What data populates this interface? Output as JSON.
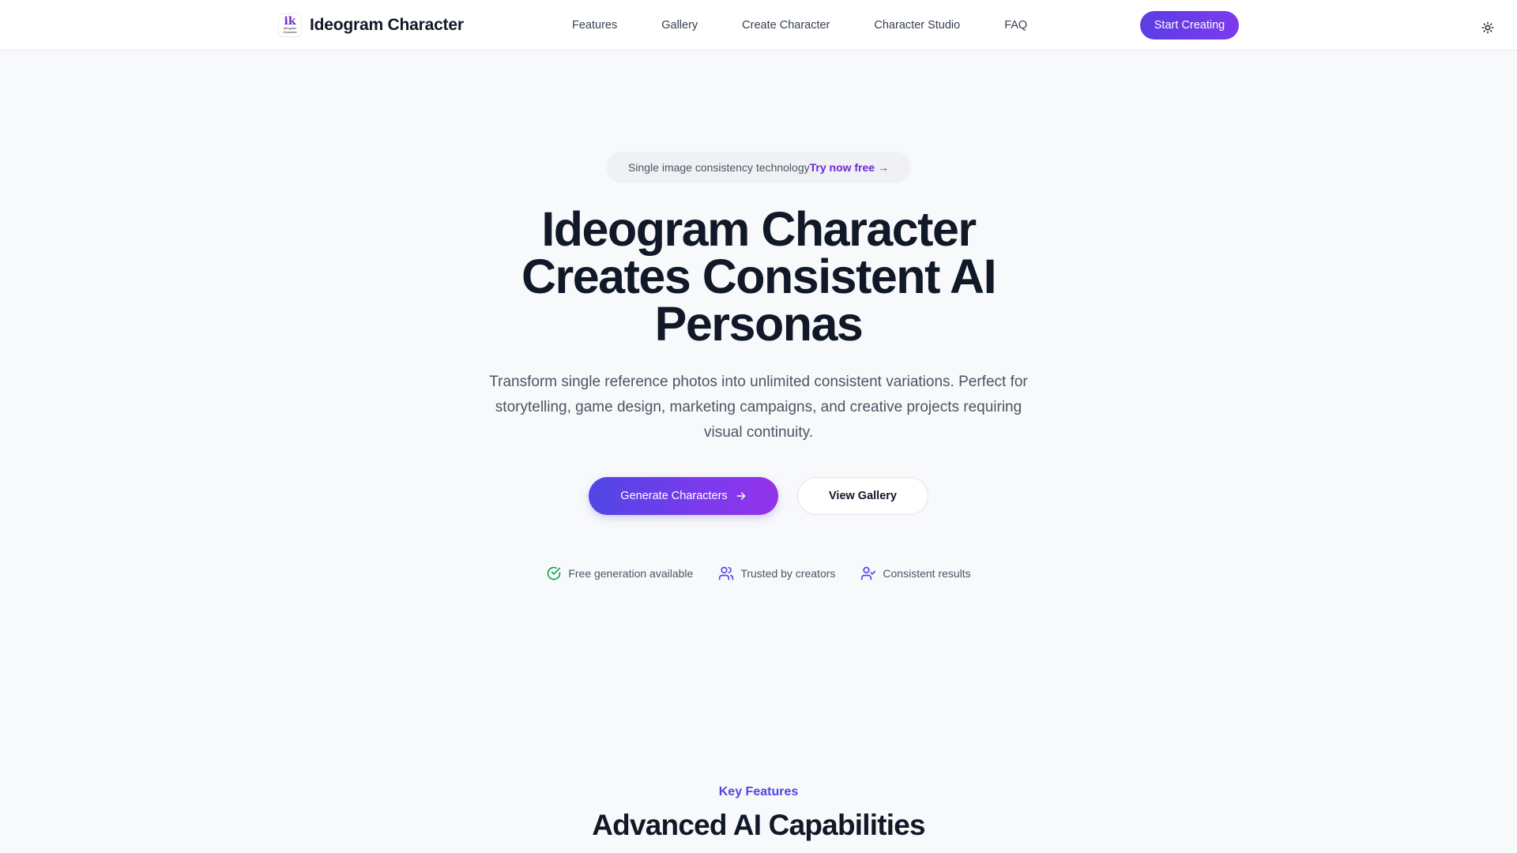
{
  "header": {
    "brand_name": "Ideogram Character",
    "logo_mark": "ik",
    "logo_text": "Ideogram Character",
    "nav": [
      {
        "label": "Features"
      },
      {
        "label": "Gallery"
      },
      {
        "label": "Create Character"
      },
      {
        "label": "Character Studio"
      },
      {
        "label": "FAQ"
      }
    ],
    "cta_label": "Start Creating",
    "theme_icon": "sun-icon"
  },
  "hero": {
    "pill_text": "Single image consistency technology",
    "pill_link": "Try now free →",
    "title_lines": [
      "Ideogram Character",
      "Creates Consistent AI",
      "Personas"
    ],
    "subtitle": "Transform single reference photos into unlimited consistent variations. Perfect for storytelling, game design, marketing campaigns, and creative projects requiring visual continuity.",
    "primary_button": "Generate Characters",
    "secondary_button": "View Gallery",
    "badges": [
      {
        "label": "Free generation available",
        "icon": "check-circle-icon",
        "color": "#16a34a"
      },
      {
        "label": "Trusted by creators",
        "icon": "users-icon",
        "color": "#4f46e5"
      },
      {
        "label": "Consistent results",
        "icon": "user-check-icon",
        "color": "#4f46e5"
      }
    ]
  },
  "features": {
    "eyebrow": "Key Features",
    "title": "Advanced AI Capabilities"
  },
  "colors": {
    "accent": "#4f46e5",
    "accent_purple": "#7c3aed",
    "background": "#f8f9fb",
    "text": "#111827",
    "success": "#16a34a"
  }
}
